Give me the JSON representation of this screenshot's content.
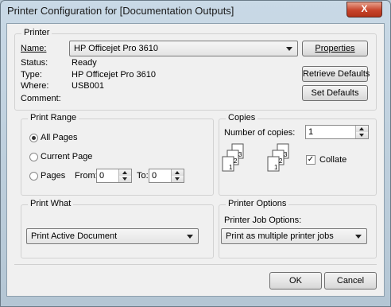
{
  "window": {
    "title": "Printer Configuration for [Documentation Outputs]",
    "close_label": "X"
  },
  "printer": {
    "group_label": "Printer",
    "name_label": "Name:",
    "name_value": "HP Officejet Pro 3610",
    "properties_label": "Properties",
    "status_label": "Status:",
    "status_value": "Ready",
    "type_label": "Type:",
    "type_value": "HP Officejet Pro 3610",
    "where_label": "Where:",
    "where_value": "USB001",
    "comment_label": "Comment:",
    "comment_value": "",
    "retrieve_defaults_label": "Retrieve Defaults",
    "set_defaults_label": "Set Defaults"
  },
  "print_range": {
    "group_label": "Print Range",
    "all_pages_label": "All Pages",
    "current_page_label": "Current Page",
    "pages_label": "Pages",
    "from_label": "From:",
    "from_value": "0",
    "to_label": "To:",
    "to_value": "0",
    "selected": "all_pages"
  },
  "copies": {
    "group_label": "Copies",
    "number_label": "Number of copies:",
    "number_value": "1",
    "collate_label": "Collate",
    "collate_checked": true,
    "collate_glyph": "✓",
    "collate_pages": [
      "3",
      "2",
      "1",
      "3",
      "2",
      "1"
    ]
  },
  "print_what": {
    "group_label": "Print What",
    "value": "Print Active Document"
  },
  "printer_options": {
    "group_label": "Printer Options",
    "job_options_label": "Printer Job Options:",
    "job_options_value": "Print as multiple printer jobs"
  },
  "footer": {
    "ok_label": "OK",
    "cancel_label": "Cancel"
  }
}
